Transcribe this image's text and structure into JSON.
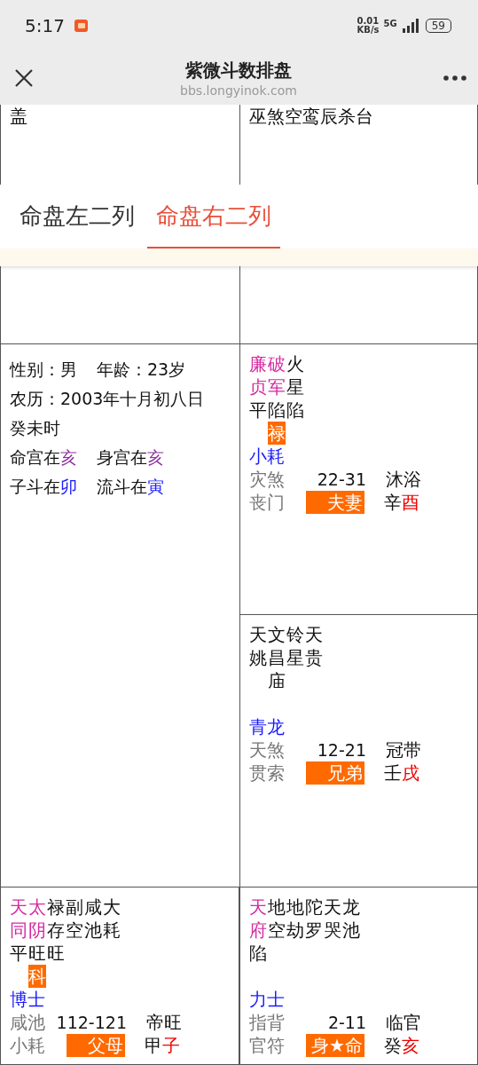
{
  "status_bar": {
    "time": "5:17",
    "net_speed": "0.01",
    "net_unit": "KB/s",
    "network": "5G",
    "battery": "59"
  },
  "header": {
    "title": "紫微斗数排盘",
    "url": "bbs.longyinok.com"
  },
  "top_cells": [
    {
      "text": "盖"
    },
    {
      "text": "巫煞空鸾辰杀台"
    }
  ],
  "tabs": [
    {
      "label": "命盘左二列",
      "selected": false
    },
    {
      "label": "命盘右二列",
      "selected": true
    }
  ],
  "info": {
    "lines": [
      [
        {
          "text": "性别：男"
        },
        {
          "text": "年龄：23岁"
        }
      ],
      [
        {
          "text": "农历：2003年十月初八日"
        }
      ],
      [
        {
          "text": "癸未时"
        }
      ],
      [
        {
          "text": "命宫在",
          "highlight": "亥",
          "color": "#8e2f9e"
        },
        {
          "text": "身宫在",
          "highlight": "亥",
          "color": "#8e2f9e"
        }
      ],
      [
        {
          "text": "子斗在",
          "highlight": "卯",
          "color": "#1a1aff"
        },
        {
          "text": "流斗在",
          "highlight": "寅",
          "color": "#1a1aff"
        }
      ]
    ]
  },
  "palaces": [
    {
      "stars": [
        {
          "name": "廉贞",
          "kind": "major",
          "brightness": "平"
        },
        {
          "name": "破军",
          "kind": "major",
          "brightness": "陷",
          "transform": "禄"
        },
        {
          "name": "火星",
          "kind": "minor",
          "brightness": "陷"
        }
      ],
      "boshi": "小耗",
      "suiqian": "灾煞",
      "jiangqian": "丧门",
      "age_range": "22-31",
      "growth": "沐浴",
      "palace": "夫妻",
      "stem": "辛",
      "branch": "酉"
    },
    {
      "stars": [
        {
          "name": "天姚",
          "kind": "minor"
        },
        {
          "name": "文昌",
          "kind": "minor",
          "brightness": "庙"
        },
        {
          "name": "铃星",
          "kind": "minor"
        },
        {
          "name": "天贵",
          "kind": "minor"
        }
      ],
      "boshi": "青龙",
      "suiqian": "天煞",
      "jiangqian": "贯索",
      "age_range": "12-21",
      "growth": "冠带",
      "palace": "兄弟",
      "stem": "壬",
      "branch": "戌"
    },
    {
      "stars": [
        {
          "name": "天同",
          "kind": "major",
          "brightness": "平"
        },
        {
          "name": "太阴",
          "kind": "major",
          "brightness": "旺",
          "transform": "科"
        },
        {
          "name": "禄存",
          "kind": "minor",
          "brightness": "旺"
        },
        {
          "name": "副空",
          "kind": "minor"
        },
        {
          "name": "咸池",
          "kind": "minor"
        },
        {
          "name": "大耗",
          "kind": "minor"
        }
      ],
      "boshi": "博士",
      "suiqian": "咸池",
      "jiangqian": "小耗",
      "age_range": "112-121",
      "growth": "帝旺",
      "palace": "父母",
      "stem": "甲",
      "branch": "子"
    },
    {
      "stars": [
        {
          "name": "天府",
          "kind": "major",
          "brightness": "陷"
        },
        {
          "name": "地空",
          "kind": "minor"
        },
        {
          "name": "地劫",
          "kind": "minor"
        },
        {
          "name": "陀罗",
          "kind": "minor"
        },
        {
          "name": "天哭",
          "kind": "minor"
        },
        {
          "name": "龙池",
          "kind": "minor"
        }
      ],
      "boshi": "力士",
      "suiqian": "指背",
      "jiangqian": "官符",
      "age_range": "2-11",
      "growth": "临官",
      "palace": "身★命",
      "stem": "癸",
      "branch": "亥"
    }
  ]
}
